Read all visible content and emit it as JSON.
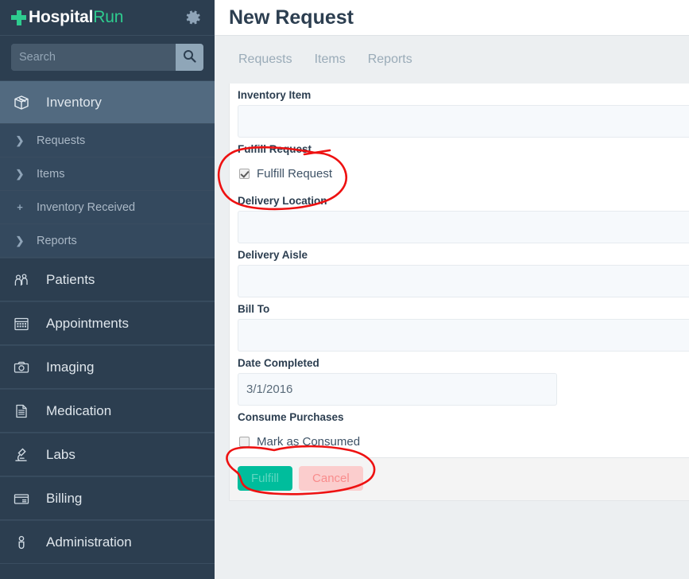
{
  "app": {
    "brand_name": "Hospital",
    "brand_suffix": "Run",
    "gear_icon": "gear-icon",
    "logo_icon": "medical-cross-icon"
  },
  "search": {
    "placeholder": "Search",
    "value": "",
    "button_icon": "search-icon"
  },
  "sidebar": {
    "items": [
      {
        "label": "Inventory",
        "icon": "box-icon",
        "active": true
      },
      {
        "label": "Patients",
        "icon": "people-icon",
        "active": false
      },
      {
        "label": "Appointments",
        "icon": "calendar-icon",
        "active": false
      },
      {
        "label": "Imaging",
        "icon": "camera-icon",
        "active": false
      },
      {
        "label": "Medication",
        "icon": "document-icon",
        "active": false
      },
      {
        "label": "Labs",
        "icon": "microscope-icon",
        "active": false
      },
      {
        "label": "Billing",
        "icon": "card-icon",
        "active": false
      },
      {
        "label": "Administration",
        "icon": "person-icon",
        "active": false
      }
    ],
    "sub_items": [
      {
        "label": "Requests",
        "icon": "chevron-right-icon",
        "glyph": "❯"
      },
      {
        "label": "Items",
        "icon": "chevron-right-icon",
        "glyph": "❯"
      },
      {
        "label": "Inventory Received",
        "icon": "plus-icon",
        "glyph": "+"
      },
      {
        "label": "Reports",
        "icon": "chevron-right-icon",
        "glyph": "❯"
      }
    ]
  },
  "header": {
    "title": "New Request"
  },
  "tabs": [
    {
      "label": "Requests"
    },
    {
      "label": "Items"
    },
    {
      "label": "Reports"
    }
  ],
  "form": {
    "fields": [
      {
        "label": "Inventory Item",
        "value": "",
        "narrow": false
      },
      {
        "label": "Delivery Location",
        "value": "",
        "narrow": false
      },
      {
        "label": "Delivery Aisle",
        "value": "",
        "narrow": false
      },
      {
        "label": "Bill To",
        "value": "",
        "narrow": false
      },
      {
        "label": "Date Completed",
        "value": "3/1/2016",
        "narrow": true
      }
    ],
    "fulfill_section": {
      "label": "Fulfill Request",
      "checkbox_label": "Fulfill Request",
      "checked": true
    },
    "consume_section": {
      "label": "Consume Purchases",
      "checkbox_label": "Mark as Consumed",
      "checked": false
    },
    "buttons": {
      "fulfill_label": "Fulfill",
      "cancel_label": "Cancel"
    }
  },
  "colors": {
    "sidebar_bg": "#2c3e50",
    "sidebar_sub_bg": "#34495e",
    "sidebar_active": "#526a80",
    "brand_accent": "#2ecc8f",
    "main_bg": "#eceff1",
    "panel_bg": "#ffffff",
    "input_bg": "#f6f9fc",
    "fulfill_btn": "#00bd9c",
    "cancel_btn": "#fbcdcd",
    "annotation_red": "#ee1111",
    "title_text": "#2c3e50"
  },
  "annotations": {
    "circle_fulfill": "hand-drawn-red-circle-around-fulfill-request",
    "circle_consume": "hand-drawn-red-circle-around-mark-as-consumed"
  }
}
